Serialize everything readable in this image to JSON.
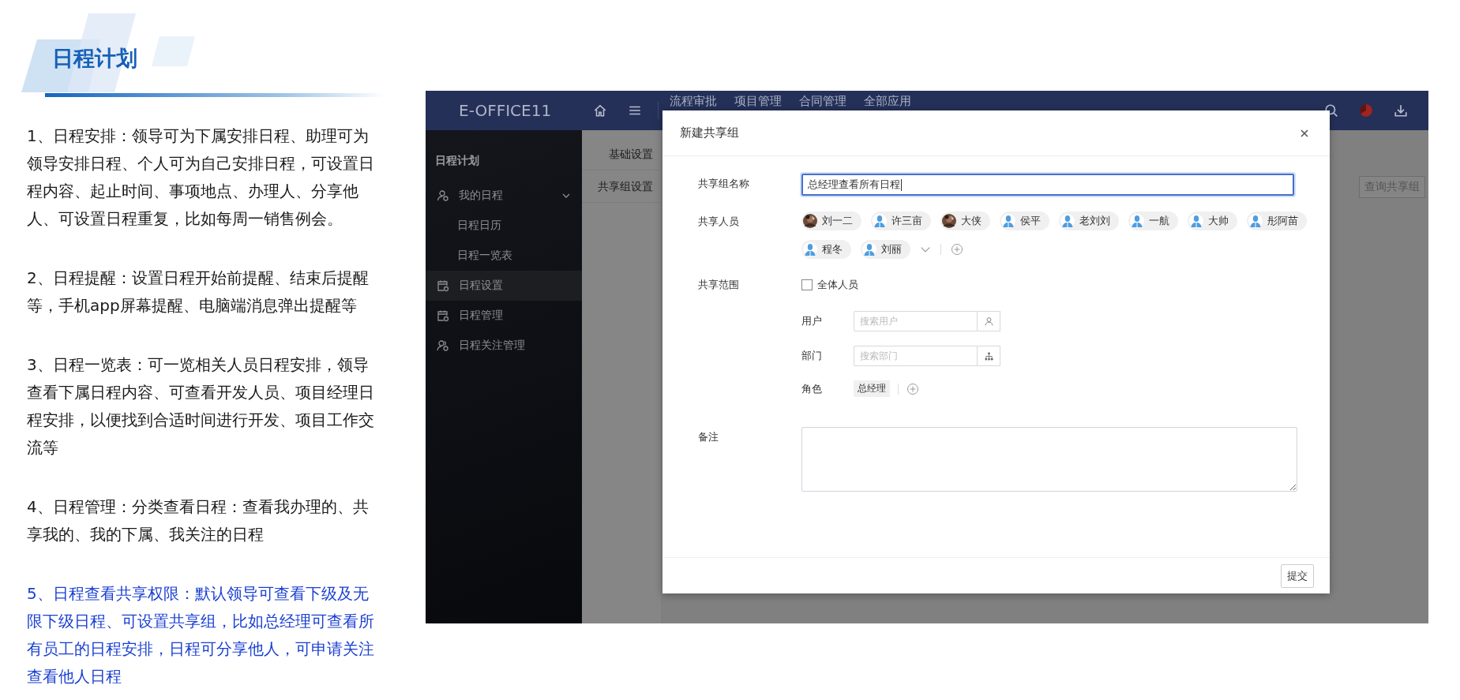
{
  "header": {
    "title": "日程计划"
  },
  "features": [
    {
      "text": "1、日程安排：领导可为下属安排日程、助理可为领导安排日程、个人可为自己安排日程，可设置日程内容、起止时间、事项地点、办理人、分享他人、可设置日程重复，比如每周一销售例会。",
      "highlighted": false
    },
    {
      "text": "2、日程提醒：设置日程开始前提醒、结束后提醒等，手机app屏幕提醒、电脑端消息弹出提醒等",
      "highlighted": false
    },
    {
      "text": "3、日程一览表：可一览相关人员日程安排，领导查看下属日程内容、可查看开发人员、项目经理日程安排，以便找到合适时间进行开发、项目工作交流等",
      "highlighted": false
    },
    {
      "text": "4、日程管理：分类查看日程：查看我办理的、共享我的、我的下属、我关注的日程",
      "highlighted": false
    },
    {
      "text": "5、日程查看共享权限：默认领导可查看下级及无限下级日程、可设置共享组，比如总经理可查看所有员工的日程安排，日程可分享他人，可申请关注查看他人日程",
      "highlighted": true
    }
  ],
  "app": {
    "logo": "E-OFFICE11",
    "nav": [
      "流程审批",
      "项目管理",
      "合同管理",
      "全部应用"
    ],
    "sidebar": {
      "title": "日程计划",
      "items": [
        {
          "label": "我的日程",
          "kind": "user",
          "selected": false,
          "expanded": true,
          "children": [
            {
              "label": "日程日历",
              "selected": false
            },
            {
              "label": "日程一览表",
              "selected": false
            }
          ]
        },
        {
          "label": "日程设置",
          "kind": "calendar",
          "selected": true
        },
        {
          "label": "日程管理",
          "kind": "calendar",
          "selected": false
        },
        {
          "label": "日程关注管理",
          "kind": "users",
          "selected": false
        }
      ]
    },
    "subtabs": [
      "基础设置",
      "共享组设置"
    ],
    "query_button": "查询共享组",
    "dialog": {
      "title": "新建共享组",
      "name": {
        "label": "共享组名称",
        "value": "总经理查看所有日程"
      },
      "members": {
        "label": "共享人员",
        "people": [
          {
            "name": "刘一二"
          },
          {
            "name": "许三亩",
            "kind": "default"
          },
          {
            "name": "大侠"
          },
          {
            "name": "侯平",
            "kind": "default"
          },
          {
            "name": "老刘刘",
            "kind": "default"
          },
          {
            "name": "一航",
            "kind": "default"
          },
          {
            "name": "大帅",
            "kind": "default"
          },
          {
            "name": "彤阿苗",
            "kind": "default"
          },
          {
            "name": "程冬",
            "kind": "default"
          },
          {
            "name": "刘丽",
            "kind": "default"
          }
        ]
      },
      "scope": {
        "label": "共享范围",
        "all": {
          "label": "全体人员",
          "checked": false
        },
        "user": {
          "label": "用户",
          "placeholder": "搜索用户"
        },
        "dept": {
          "label": "部门",
          "placeholder": "搜索部门"
        },
        "role": {
          "label": "角色",
          "tags": [
            "总经理"
          ]
        }
      },
      "note": {
        "label": "备注"
      },
      "submit": "提交"
    }
  }
}
